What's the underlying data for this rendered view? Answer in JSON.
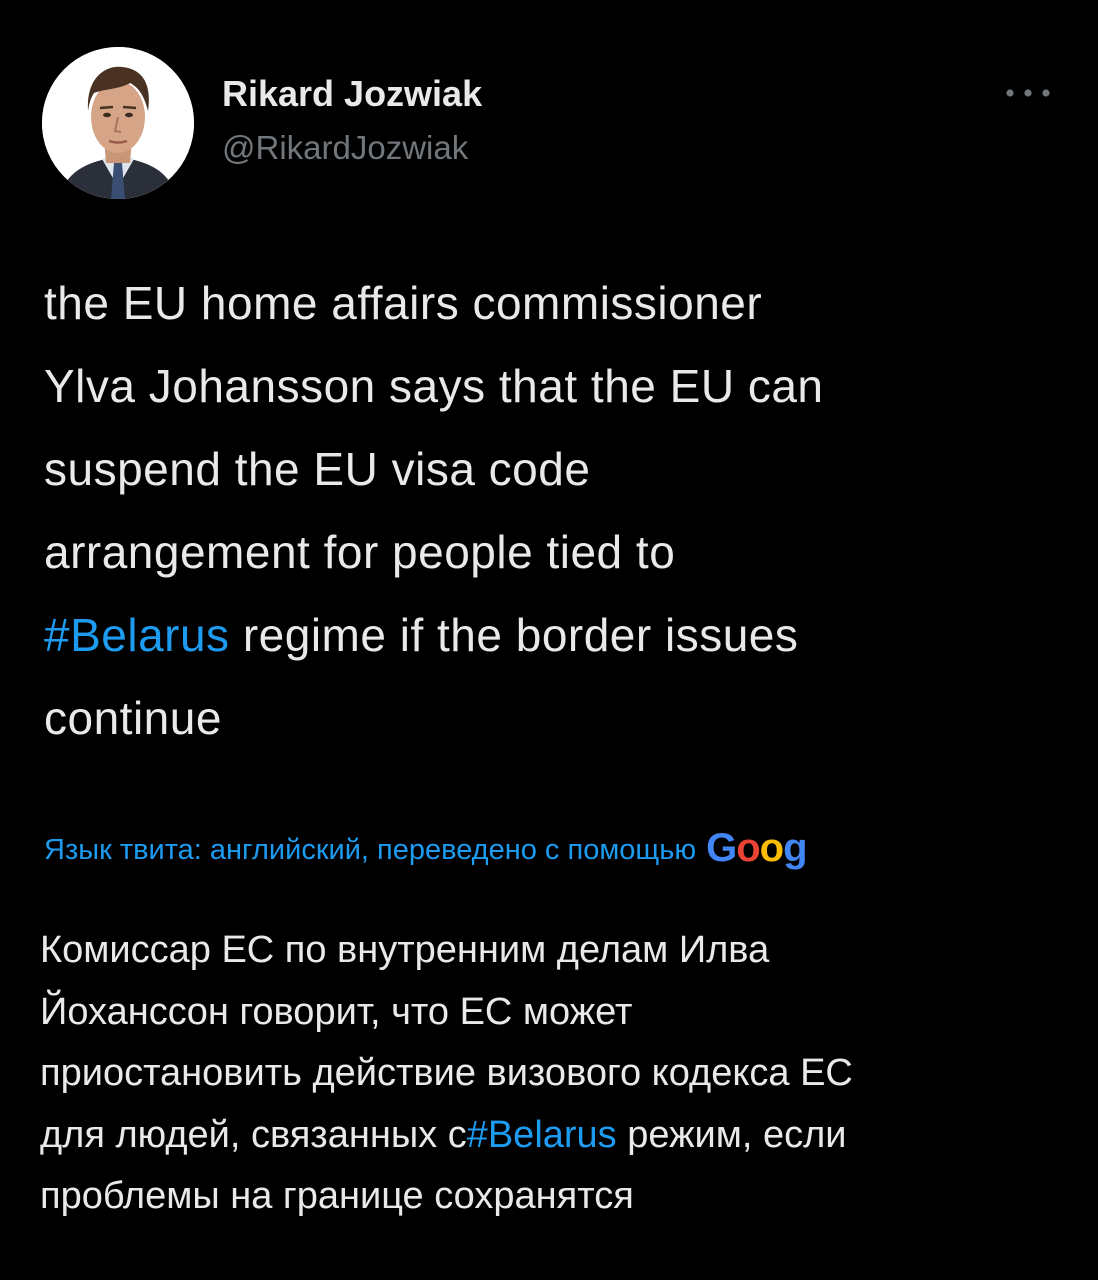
{
  "tweet": {
    "author": {
      "display_name": "Rikard Jozwiak",
      "handle": "@RikardJozwiak"
    },
    "more_icon": "more-horizontal-icon",
    "text": {
      "lines": [
        "the EU home affairs commissioner",
        "Ylva Johansson says that the EU can",
        "suspend the EU visa code",
        "arrangement for people tied to"
      ],
      "hashtag": "#Belarus",
      "after_hashtag": " regime if the border issues",
      "last_line": "continue"
    },
    "translation": {
      "label": "Язык твита: английский, переведено с помощью",
      "google_letters": [
        "G",
        "o",
        "o",
        "g"
      ],
      "lines": [
        "Комиссар ЕС по внутренним делам Илва",
        "Йохансcон говорит, что ЕС может",
        "приостановить действие визового кодекса ЕС"
      ],
      "line4_before": "для людей, связанных с",
      "hashtag": "#Belarus",
      "line4_after": " режим, если",
      "last_line": "проблемы на границе сохранятся"
    }
  },
  "colors": {
    "background": "#000000",
    "text_primary": "#e7e9ea",
    "text_secondary": "#71767b",
    "accent": "#1d9bf0",
    "google_blue": "#4285f4",
    "google_red": "#ea4335",
    "google_yellow": "#fbbc05",
    "google_green": "#34a853"
  }
}
